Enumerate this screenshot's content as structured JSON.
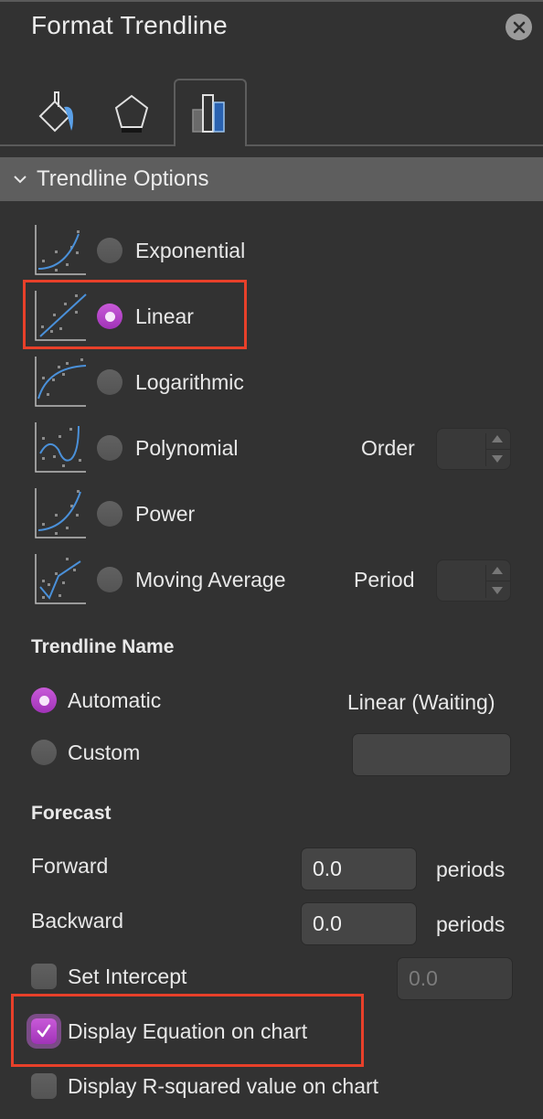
{
  "panel": {
    "title": "Format Trendline",
    "close_icon": "close-icon"
  },
  "tabs": [
    {
      "name": "fill-line",
      "icon": "paint-bucket-icon",
      "active": false
    },
    {
      "name": "effects",
      "icon": "pentagon-icon",
      "active": false
    },
    {
      "name": "trendline-options",
      "icon": "bar-chart-icon",
      "active": true
    }
  ],
  "section": {
    "label": "Trendline Options",
    "expanded": true
  },
  "trendline_types": [
    {
      "label": "Exponential",
      "icon": "exponential-trend-icon",
      "selected": false
    },
    {
      "label": "Linear",
      "icon": "linear-trend-icon",
      "selected": true
    },
    {
      "label": "Logarithmic",
      "icon": "logarithmic-trend-icon",
      "selected": false
    },
    {
      "label": "Polynomial",
      "icon": "polynomial-trend-icon",
      "selected": false
    },
    {
      "label": "Power",
      "icon": "power-trend-icon",
      "selected": false
    },
    {
      "label": "Moving Average",
      "icon": "moving-average-trend-icon",
      "selected": false
    }
  ],
  "order": {
    "label": "Order",
    "value": ""
  },
  "period": {
    "label": "Period",
    "value": ""
  },
  "trendline_name": {
    "heading": "Trendline Name",
    "automatic": {
      "label": "Automatic",
      "selected": true,
      "value": "Linear (Waiting)"
    },
    "custom": {
      "label": "Custom",
      "selected": false,
      "value": ""
    }
  },
  "forecast": {
    "heading": "Forecast",
    "forward": {
      "label": "Forward",
      "value": "0.0",
      "unit": "periods"
    },
    "backward": {
      "label": "Backward",
      "value": "0.0",
      "unit": "periods"
    }
  },
  "set_intercept": {
    "label": "Set Intercept",
    "checked": false,
    "value": "0.0"
  },
  "display_equation": {
    "label": "Display Equation on chart",
    "checked": true
  },
  "display_r_squared": {
    "label": "Display R-squared value on chart",
    "checked": false
  },
  "colors": {
    "accent": "#b342c8",
    "highlight_box": "#e8402a",
    "trend_line": "#4a90d9",
    "panel_bg": "#323232",
    "section_header_bg": "#5e5e5e"
  }
}
